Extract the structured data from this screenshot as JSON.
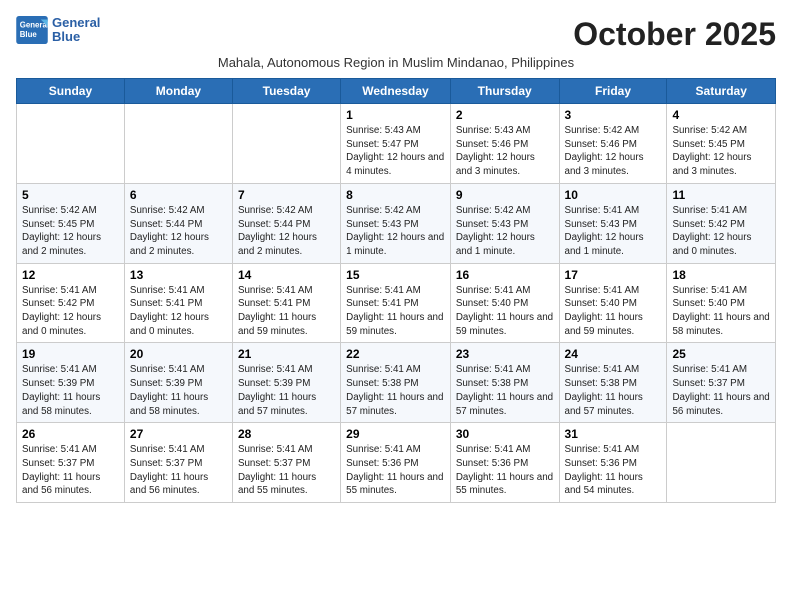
{
  "header": {
    "logo_line1": "General",
    "logo_line2": "Blue",
    "month_title": "October 2025",
    "subtitle": "Mahala, Autonomous Region in Muslim Mindanao, Philippines"
  },
  "weekdays": [
    "Sunday",
    "Monday",
    "Tuesday",
    "Wednesday",
    "Thursday",
    "Friday",
    "Saturday"
  ],
  "weeks": [
    [
      {
        "day": "",
        "content": ""
      },
      {
        "day": "",
        "content": ""
      },
      {
        "day": "",
        "content": ""
      },
      {
        "day": "1",
        "content": "Sunrise: 5:43 AM\nSunset: 5:47 PM\nDaylight: 12 hours\nand 4 minutes."
      },
      {
        "day": "2",
        "content": "Sunrise: 5:43 AM\nSunset: 5:46 PM\nDaylight: 12 hours\nand 3 minutes."
      },
      {
        "day": "3",
        "content": "Sunrise: 5:42 AM\nSunset: 5:46 PM\nDaylight: 12 hours\nand 3 minutes."
      },
      {
        "day": "4",
        "content": "Sunrise: 5:42 AM\nSunset: 5:45 PM\nDaylight: 12 hours\nand 3 minutes."
      }
    ],
    [
      {
        "day": "5",
        "content": "Sunrise: 5:42 AM\nSunset: 5:45 PM\nDaylight: 12 hours\nand 2 minutes."
      },
      {
        "day": "6",
        "content": "Sunrise: 5:42 AM\nSunset: 5:44 PM\nDaylight: 12 hours\nand 2 minutes."
      },
      {
        "day": "7",
        "content": "Sunrise: 5:42 AM\nSunset: 5:44 PM\nDaylight: 12 hours\nand 2 minutes."
      },
      {
        "day": "8",
        "content": "Sunrise: 5:42 AM\nSunset: 5:43 PM\nDaylight: 12 hours\nand 1 minute."
      },
      {
        "day": "9",
        "content": "Sunrise: 5:42 AM\nSunset: 5:43 PM\nDaylight: 12 hours\nand 1 minute."
      },
      {
        "day": "10",
        "content": "Sunrise: 5:41 AM\nSunset: 5:43 PM\nDaylight: 12 hours\nand 1 minute."
      },
      {
        "day": "11",
        "content": "Sunrise: 5:41 AM\nSunset: 5:42 PM\nDaylight: 12 hours\nand 0 minutes."
      }
    ],
    [
      {
        "day": "12",
        "content": "Sunrise: 5:41 AM\nSunset: 5:42 PM\nDaylight: 12 hours\nand 0 minutes."
      },
      {
        "day": "13",
        "content": "Sunrise: 5:41 AM\nSunset: 5:41 PM\nDaylight: 12 hours\nand 0 minutes."
      },
      {
        "day": "14",
        "content": "Sunrise: 5:41 AM\nSunset: 5:41 PM\nDaylight: 11 hours\nand 59 minutes."
      },
      {
        "day": "15",
        "content": "Sunrise: 5:41 AM\nSunset: 5:41 PM\nDaylight: 11 hours\nand 59 minutes."
      },
      {
        "day": "16",
        "content": "Sunrise: 5:41 AM\nSunset: 5:40 PM\nDaylight: 11 hours\nand 59 minutes."
      },
      {
        "day": "17",
        "content": "Sunrise: 5:41 AM\nSunset: 5:40 PM\nDaylight: 11 hours\nand 59 minutes."
      },
      {
        "day": "18",
        "content": "Sunrise: 5:41 AM\nSunset: 5:40 PM\nDaylight: 11 hours\nand 58 minutes."
      }
    ],
    [
      {
        "day": "19",
        "content": "Sunrise: 5:41 AM\nSunset: 5:39 PM\nDaylight: 11 hours\nand 58 minutes."
      },
      {
        "day": "20",
        "content": "Sunrise: 5:41 AM\nSunset: 5:39 PM\nDaylight: 11 hours\nand 58 minutes."
      },
      {
        "day": "21",
        "content": "Sunrise: 5:41 AM\nSunset: 5:39 PM\nDaylight: 11 hours\nand 57 minutes."
      },
      {
        "day": "22",
        "content": "Sunrise: 5:41 AM\nSunset: 5:38 PM\nDaylight: 11 hours\nand 57 minutes."
      },
      {
        "day": "23",
        "content": "Sunrise: 5:41 AM\nSunset: 5:38 PM\nDaylight: 11 hours\nand 57 minutes."
      },
      {
        "day": "24",
        "content": "Sunrise: 5:41 AM\nSunset: 5:38 PM\nDaylight: 11 hours\nand 57 minutes."
      },
      {
        "day": "25",
        "content": "Sunrise: 5:41 AM\nSunset: 5:37 PM\nDaylight: 11 hours\nand 56 minutes."
      }
    ],
    [
      {
        "day": "26",
        "content": "Sunrise: 5:41 AM\nSunset: 5:37 PM\nDaylight: 11 hours\nand 56 minutes."
      },
      {
        "day": "27",
        "content": "Sunrise: 5:41 AM\nSunset: 5:37 PM\nDaylight: 11 hours\nand 56 minutes."
      },
      {
        "day": "28",
        "content": "Sunrise: 5:41 AM\nSunset: 5:37 PM\nDaylight: 11 hours\nand 55 minutes."
      },
      {
        "day": "29",
        "content": "Sunrise: 5:41 AM\nSunset: 5:36 PM\nDaylight: 11 hours\nand 55 minutes."
      },
      {
        "day": "30",
        "content": "Sunrise: 5:41 AM\nSunset: 5:36 PM\nDaylight: 11 hours\nand 55 minutes."
      },
      {
        "day": "31",
        "content": "Sunrise: 5:41 AM\nSunset: 5:36 PM\nDaylight: 11 hours\nand 54 minutes."
      },
      {
        "day": "",
        "content": ""
      }
    ]
  ]
}
